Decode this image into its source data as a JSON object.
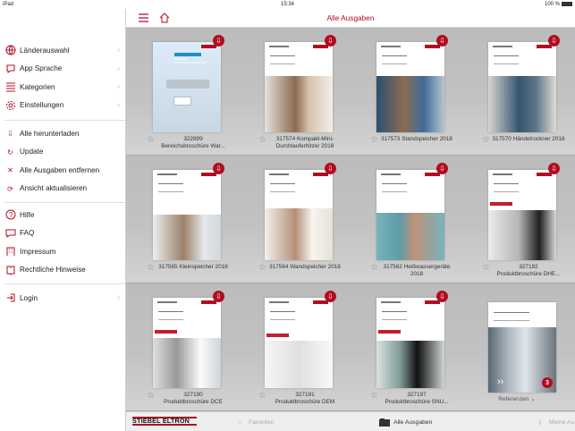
{
  "status": {
    "device": "iPad",
    "time": "15:34",
    "battery": "100 %"
  },
  "sidebar": {
    "group1": [
      {
        "label": "Länderauswahl",
        "icon": "globe-icon",
        "chevron": true
      },
      {
        "label": "App Sprache",
        "icon": "speech-bubble-icon",
        "chevron": true
      },
      {
        "label": "Kategorien",
        "icon": "list-icon",
        "chevron": true
      },
      {
        "label": "Einstellungen",
        "icon": "gear-icon",
        "chevron": true
      }
    ],
    "group2": [
      {
        "label": "Alle herunterladen",
        "icon": "download-icon"
      },
      {
        "label": "Update",
        "icon": "refresh-icon"
      },
      {
        "label": "Alle Ausgaben entfernen",
        "icon": "close-icon"
      },
      {
        "label": "Ansicht aktualisieren",
        "icon": "reload-icon"
      }
    ],
    "group3": [
      {
        "label": "Hilfe",
        "icon": "question-icon"
      },
      {
        "label": "FAQ",
        "icon": "chat-icon"
      },
      {
        "label": "Impressum",
        "icon": "building-icon"
      },
      {
        "label": "Rechtliche Hinweise",
        "icon": "book-icon"
      }
    ],
    "group4": [
      {
        "label": "Login",
        "icon": "login-icon",
        "chevron": true
      }
    ]
  },
  "top": {
    "title": "Alle Ausgaben",
    "menu_icon": "menu-icon",
    "home_icon": "home-icon"
  },
  "catalogs": [
    {
      "code": "322899",
      "title": "Bereichsbroschüre War..."
    },
    {
      "code": "317574",
      "title": "Kompakt-Mini-Durchlauferhitzer 2018"
    },
    {
      "code": "317573",
      "title": "Standspeicher 2018"
    },
    {
      "code": "317570",
      "title": "Händetrockner 2018"
    },
    {
      "code": "317565",
      "title": "Kleinspeicher 2018"
    },
    {
      "code": "317564",
      "title": "Wandspeicher 2018"
    },
    {
      "code": "317562",
      "title": "Heißwassergeräte 2018"
    },
    {
      "code": "327192",
      "title": "Produktbroschüre DHE..."
    },
    {
      "code": "327190",
      "title": "Produktbroschüre DCE"
    },
    {
      "code": "327191",
      "title": "Produktbroschüre DEM"
    },
    {
      "code": "327197",
      "title": "Produktbroschüre SNU..."
    }
  ],
  "reference_card": {
    "label": "Referenzen",
    "badge": "3"
  },
  "cover_texts": {
    "first": "Effiziente Warmwasserlösungen"
  },
  "bottom": {
    "brand": "STIEBEL ELTRON",
    "tabs": [
      {
        "label": "Favoriten",
        "icon": "star-icon"
      },
      {
        "label": "Alle Ausgaben",
        "icon": "folder-icon"
      },
      {
        "label": "Meine Au",
        "icon": "download-icon"
      }
    ]
  },
  "colors": {
    "accent": "#b00d23",
    "background": "#c2c2c2"
  }
}
